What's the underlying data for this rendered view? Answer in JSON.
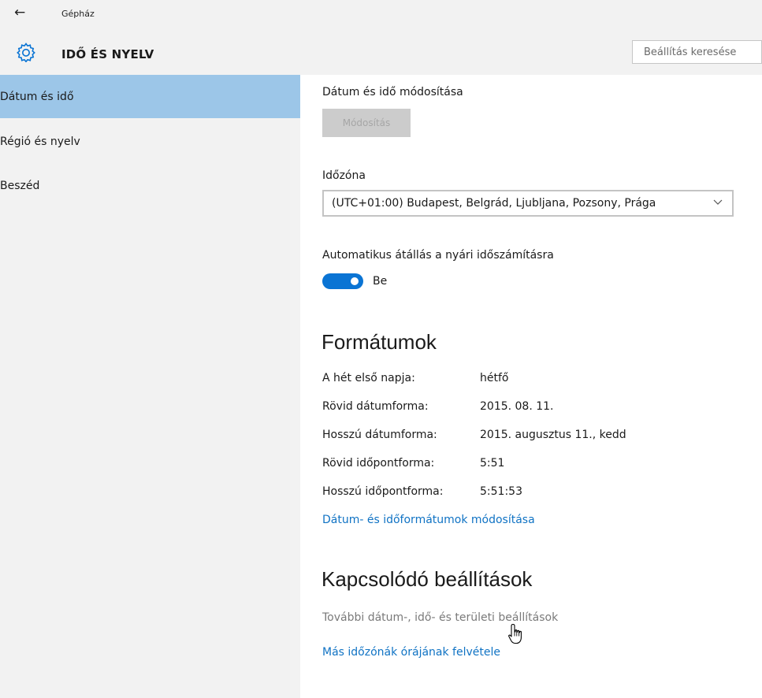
{
  "window": {
    "app_title": "Gépház",
    "back_icon": "back-arrow-icon"
  },
  "header": {
    "section_title": "IDŐ ÉS NYELV",
    "icon": "gear-icon",
    "search_placeholder": "Beállítás keresése"
  },
  "sidebar": {
    "items": [
      {
        "label": "Dátum és idő",
        "active": true
      },
      {
        "label": "Régió és nyelv",
        "active": false
      },
      {
        "label": "Beszéd",
        "active": false
      }
    ]
  },
  "main": {
    "change_datetime": {
      "label": "Dátum és idő módosítása",
      "button": "Módosítás",
      "enabled": false
    },
    "timezone": {
      "label": "Időzóna",
      "value": "(UTC+01:00) Budapest, Belgrád, Ljubljana, Pozsony, Prága"
    },
    "dst": {
      "label": "Automatikus átállás a nyári időszámításra",
      "state": "Be",
      "on": true
    },
    "formats": {
      "heading": "Formátumok",
      "rows": [
        {
          "key": "A hét első napja:",
          "value": "hétfő"
        },
        {
          "key": "Rövid dátumforma:",
          "value": "2015. 08. 11."
        },
        {
          "key": "Hosszú dátumforma:",
          "value": "2015. augusztus 11., kedd"
        },
        {
          "key": "Rövid időpontforma:",
          "value": "5:51"
        },
        {
          "key": "Hosszú időpontforma:",
          "value": "5:51:53"
        }
      ],
      "change_link": "Dátum- és időformátumok módosítása"
    },
    "related": {
      "heading": "Kapcsolódó beállítások",
      "links": [
        "További dátum-, idő- és területi beállítások",
        "Más időzónák órájának felvétele"
      ]
    }
  },
  "colors": {
    "accent": "#0a74d4",
    "selected_nav": "#9cc6e8",
    "link": "#1073c4",
    "chrome": "#f2f2f2"
  }
}
